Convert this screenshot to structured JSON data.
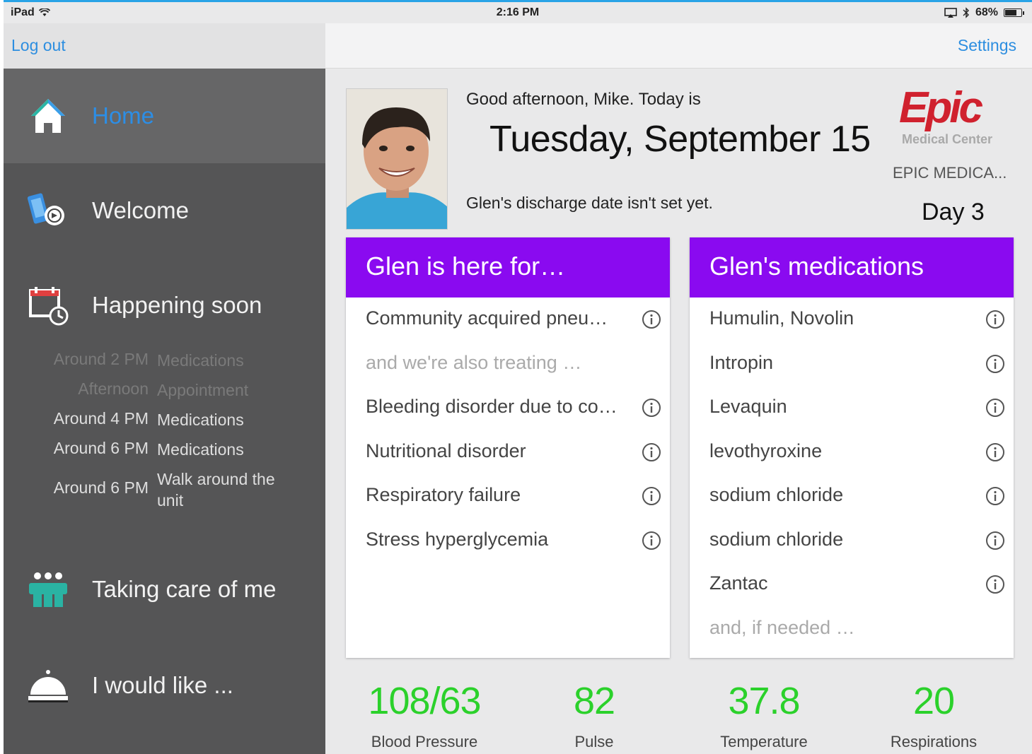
{
  "status_bar": {
    "device": "iPad",
    "time": "2:16 PM",
    "battery": "68%"
  },
  "nav": {
    "logout": "Log out",
    "settings": "Settings"
  },
  "sidebar": {
    "items": [
      {
        "label": "Home",
        "icon": "home-icon"
      },
      {
        "label": "Welcome",
        "icon": "welcome-icon"
      },
      {
        "label": "Happening soon",
        "icon": "calendar-clock-icon"
      },
      {
        "label": "Taking care of me",
        "icon": "care-team-icon"
      },
      {
        "label": "I would like ...",
        "icon": "service-bell-icon"
      }
    ],
    "schedule": [
      {
        "when": "Around 2 PM",
        "what": "Medications",
        "state": "past"
      },
      {
        "when": "Afternoon",
        "what": "Appointment",
        "state": "past"
      },
      {
        "when": "Around 4 PM",
        "what": "Medications",
        "state": "upcoming"
      },
      {
        "when": "Around 6 PM",
        "what": "Medications",
        "state": "upcoming"
      },
      {
        "when": "Around 6 PM",
        "what": "Walk around the unit",
        "state": "upcoming"
      }
    ]
  },
  "header": {
    "greeting": "Good afternoon, Mike. Today is",
    "date": "Tuesday, September 15",
    "discharge": "Glen's discharge date isn't set yet.",
    "logo_text": "Epic",
    "logo_sub": "Medical Center",
    "hospital": "EPIC MEDICA...",
    "day": "Day 3"
  },
  "reasons_card": {
    "title": "Glen is here for…",
    "items": [
      {
        "text": "Community acquired pneu…",
        "info": true,
        "muted": false
      },
      {
        "text": "and we're also treating …",
        "info": false,
        "muted": true
      },
      {
        "text": "Bleeding disorder due to co…",
        "info": true,
        "muted": false
      },
      {
        "text": "Nutritional disorder",
        "info": true,
        "muted": false
      },
      {
        "text": "Respiratory failure",
        "info": true,
        "muted": false
      },
      {
        "text": "Stress hyperglycemia",
        "info": true,
        "muted": false
      }
    ]
  },
  "meds_card": {
    "title": "Glen's medications",
    "items": [
      {
        "text": "Humulin, Novolin",
        "info": true,
        "muted": false
      },
      {
        "text": "Intropin",
        "info": true,
        "muted": false
      },
      {
        "text": "Levaquin",
        "info": true,
        "muted": false
      },
      {
        "text": "levothyroxine",
        "info": true,
        "muted": false
      },
      {
        "text": "sodium chloride",
        "info": true,
        "muted": false
      },
      {
        "text": "sodium chloride",
        "info": true,
        "muted": false
      },
      {
        "text": "Zantac",
        "info": true,
        "muted": false
      },
      {
        "text": "and, if needed …",
        "info": false,
        "muted": true
      }
    ]
  },
  "vitals": [
    {
      "value": "108/63",
      "label": "Blood Pressure"
    },
    {
      "value": "82",
      "label": "Pulse"
    },
    {
      "value": "37.8",
      "label": "Temperature"
    },
    {
      "value": "20",
      "label": "Respirations"
    }
  ],
  "colors": {
    "accent_blue": "#2c8ee6",
    "card_header": "#8a0af0",
    "vital_green": "#2bd12b",
    "epic_red": "#d0212e",
    "sidebar_bg": "#555556"
  }
}
